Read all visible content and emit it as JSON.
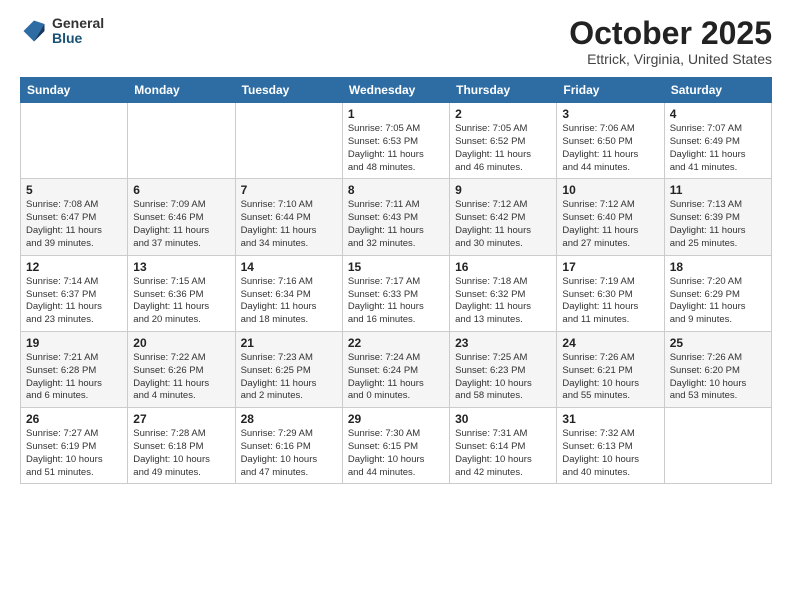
{
  "logo": {
    "general": "General",
    "blue": "Blue"
  },
  "title": "October 2025",
  "location": "Ettrick, Virginia, United States",
  "weekdays": [
    "Sunday",
    "Monday",
    "Tuesday",
    "Wednesday",
    "Thursday",
    "Friday",
    "Saturday"
  ],
  "weeks": [
    [
      {
        "day": "",
        "info": ""
      },
      {
        "day": "",
        "info": ""
      },
      {
        "day": "",
        "info": ""
      },
      {
        "day": "1",
        "info": "Sunrise: 7:05 AM\nSunset: 6:53 PM\nDaylight: 11 hours\nand 48 minutes."
      },
      {
        "day": "2",
        "info": "Sunrise: 7:05 AM\nSunset: 6:52 PM\nDaylight: 11 hours\nand 46 minutes."
      },
      {
        "day": "3",
        "info": "Sunrise: 7:06 AM\nSunset: 6:50 PM\nDaylight: 11 hours\nand 44 minutes."
      },
      {
        "day": "4",
        "info": "Sunrise: 7:07 AM\nSunset: 6:49 PM\nDaylight: 11 hours\nand 41 minutes."
      }
    ],
    [
      {
        "day": "5",
        "info": "Sunrise: 7:08 AM\nSunset: 6:47 PM\nDaylight: 11 hours\nand 39 minutes."
      },
      {
        "day": "6",
        "info": "Sunrise: 7:09 AM\nSunset: 6:46 PM\nDaylight: 11 hours\nand 37 minutes."
      },
      {
        "day": "7",
        "info": "Sunrise: 7:10 AM\nSunset: 6:44 PM\nDaylight: 11 hours\nand 34 minutes."
      },
      {
        "day": "8",
        "info": "Sunrise: 7:11 AM\nSunset: 6:43 PM\nDaylight: 11 hours\nand 32 minutes."
      },
      {
        "day": "9",
        "info": "Sunrise: 7:12 AM\nSunset: 6:42 PM\nDaylight: 11 hours\nand 30 minutes."
      },
      {
        "day": "10",
        "info": "Sunrise: 7:12 AM\nSunset: 6:40 PM\nDaylight: 11 hours\nand 27 minutes."
      },
      {
        "day": "11",
        "info": "Sunrise: 7:13 AM\nSunset: 6:39 PM\nDaylight: 11 hours\nand 25 minutes."
      }
    ],
    [
      {
        "day": "12",
        "info": "Sunrise: 7:14 AM\nSunset: 6:37 PM\nDaylight: 11 hours\nand 23 minutes."
      },
      {
        "day": "13",
        "info": "Sunrise: 7:15 AM\nSunset: 6:36 PM\nDaylight: 11 hours\nand 20 minutes."
      },
      {
        "day": "14",
        "info": "Sunrise: 7:16 AM\nSunset: 6:34 PM\nDaylight: 11 hours\nand 18 minutes."
      },
      {
        "day": "15",
        "info": "Sunrise: 7:17 AM\nSunset: 6:33 PM\nDaylight: 11 hours\nand 16 minutes."
      },
      {
        "day": "16",
        "info": "Sunrise: 7:18 AM\nSunset: 6:32 PM\nDaylight: 11 hours\nand 13 minutes."
      },
      {
        "day": "17",
        "info": "Sunrise: 7:19 AM\nSunset: 6:30 PM\nDaylight: 11 hours\nand 11 minutes."
      },
      {
        "day": "18",
        "info": "Sunrise: 7:20 AM\nSunset: 6:29 PM\nDaylight: 11 hours\nand 9 minutes."
      }
    ],
    [
      {
        "day": "19",
        "info": "Sunrise: 7:21 AM\nSunset: 6:28 PM\nDaylight: 11 hours\nand 6 minutes."
      },
      {
        "day": "20",
        "info": "Sunrise: 7:22 AM\nSunset: 6:26 PM\nDaylight: 11 hours\nand 4 minutes."
      },
      {
        "day": "21",
        "info": "Sunrise: 7:23 AM\nSunset: 6:25 PM\nDaylight: 11 hours\nand 2 minutes."
      },
      {
        "day": "22",
        "info": "Sunrise: 7:24 AM\nSunset: 6:24 PM\nDaylight: 11 hours\nand 0 minutes."
      },
      {
        "day": "23",
        "info": "Sunrise: 7:25 AM\nSunset: 6:23 PM\nDaylight: 10 hours\nand 58 minutes."
      },
      {
        "day": "24",
        "info": "Sunrise: 7:26 AM\nSunset: 6:21 PM\nDaylight: 10 hours\nand 55 minutes."
      },
      {
        "day": "25",
        "info": "Sunrise: 7:26 AM\nSunset: 6:20 PM\nDaylight: 10 hours\nand 53 minutes."
      }
    ],
    [
      {
        "day": "26",
        "info": "Sunrise: 7:27 AM\nSunset: 6:19 PM\nDaylight: 10 hours\nand 51 minutes."
      },
      {
        "day": "27",
        "info": "Sunrise: 7:28 AM\nSunset: 6:18 PM\nDaylight: 10 hours\nand 49 minutes."
      },
      {
        "day": "28",
        "info": "Sunrise: 7:29 AM\nSunset: 6:16 PM\nDaylight: 10 hours\nand 47 minutes."
      },
      {
        "day": "29",
        "info": "Sunrise: 7:30 AM\nSunset: 6:15 PM\nDaylight: 10 hours\nand 44 minutes."
      },
      {
        "day": "30",
        "info": "Sunrise: 7:31 AM\nSunset: 6:14 PM\nDaylight: 10 hours\nand 42 minutes."
      },
      {
        "day": "31",
        "info": "Sunrise: 7:32 AM\nSunset: 6:13 PM\nDaylight: 10 hours\nand 40 minutes."
      },
      {
        "day": "",
        "info": ""
      }
    ]
  ]
}
